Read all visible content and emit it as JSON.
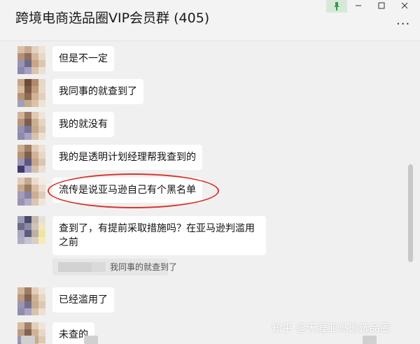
{
  "window": {
    "title": "跨境电商选品圈VIP会员群 (405)",
    "pin_icon": "pin-icon",
    "minimize_icon": "minimize-icon",
    "maximize_icon": "maximize-icon",
    "close_icon": "close-icon",
    "more_icon": "more-icon"
  },
  "messages": [
    {
      "text": "但是不一定"
    },
    {
      "text": "我同事的就查到了"
    },
    {
      "text": "我的就没有"
    },
    {
      "text": "我的是透明计划经理帮我查到的"
    },
    {
      "text": "流传是说亚马逊自己有个黑名单"
    },
    {
      "text": "查到了，有提前采取措施吗？在亚马逊判滥用之前"
    },
    {
      "text": "已经滥用了"
    },
    {
      "text": "未查的"
    }
  ],
  "quote": {
    "text": "我同事的就查到了"
  },
  "watermark": "知乎 @无涯亚马逊选品圈",
  "colors": {
    "highlight_ellipse": "#d9342b",
    "bubble": "#ffffff",
    "background": "#f0f0f0"
  }
}
